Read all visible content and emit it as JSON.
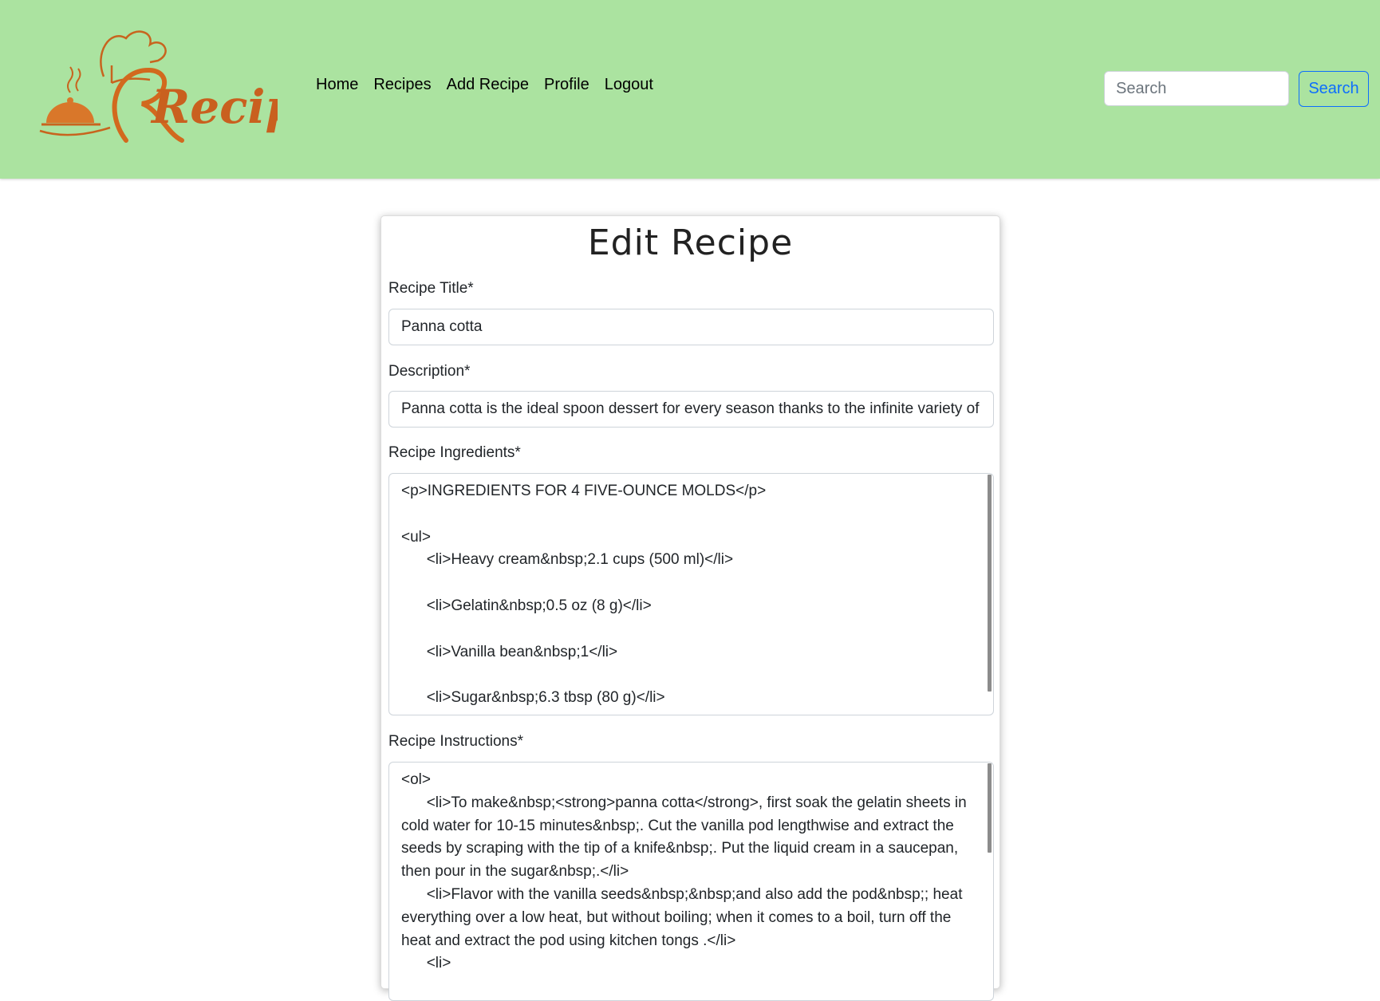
{
  "header": {
    "logo_text": "Recipes",
    "nav": [
      "Home",
      "Recipes",
      "Add Recipe",
      "Profile",
      "Logout"
    ],
    "search": {
      "placeholder": "Search",
      "button_label": "Search"
    }
  },
  "form": {
    "title": "Edit Recipe",
    "fields": {
      "title": {
        "label": "Recipe Title*",
        "value": "Panna cotta"
      },
      "description": {
        "label": "Description*",
        "value": "Panna cotta is the ideal spoon dessert for every season thanks to the infinite variety of a"
      },
      "ingredients": {
        "label": "Recipe Ingredients*",
        "value": "<p>INGREDIENTS FOR 4 FIVE-OUNCE MOLDS</p>\n\n<ul>\n      <li>Heavy cream&nbsp;2.1 cups (500 ml)</li>\n\n      <li>Gelatin&nbsp;0.5 oz (8 g)</li>\n\n      <li>Vanilla bean&nbsp;1</li>\n\n      <li>Sugar&nbsp;6.3 tbsp (80 g)</li>"
      },
      "instructions": {
        "label": "Recipe Instructions*",
        "value": "<ol>\n      <li>To make&nbsp;<strong>panna cotta</strong>, first soak the gelatin sheets in cold water for 10-15 minutes&nbsp;. Cut the vanilla pod lengthwise and extract the seeds by scraping with the tip of a knife&nbsp;. Put the liquid cream in a saucepan, then pour in the sugar&nbsp;.</li>\n      <li>Flavor with the vanilla seeds&nbsp;&nbsp;and also add the pod&nbsp;; heat everything over a low heat, but without boiling; when it comes to a boil, turn off the heat and extract the pod using kitchen tongs .</li>\n      <li>"
      }
    }
  },
  "colors": {
    "header_bg": "#abe3a0",
    "logo_orange": "#d2691e",
    "accent_blue": "#0d6efd"
  }
}
